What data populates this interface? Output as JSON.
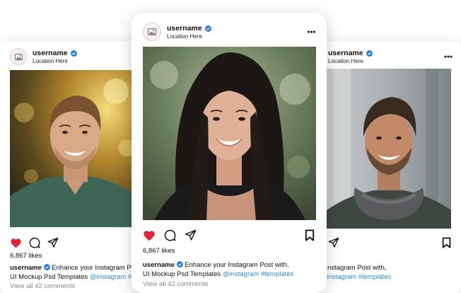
{
  "post": {
    "username": "username",
    "location": "Location Here",
    "likes": "6,867 likes",
    "caption_line1": "Enhance your Instagram Post with,",
    "caption_line2": "UI Mockup Psd Templates",
    "mention": "@instagram",
    "hashtag": "#templates",
    "comments": "View all 42 comments"
  },
  "colors": {
    "like_red": "#e0243a",
    "verified_blue": "#2a7fde",
    "link_blue": "#2d8cd0",
    "muted_gray": "#8a8a8a"
  },
  "icons": [
    "image-icon",
    "verified-icon",
    "more-icon",
    "heart-icon",
    "comment-icon",
    "share-icon",
    "bookmark-icon"
  ]
}
